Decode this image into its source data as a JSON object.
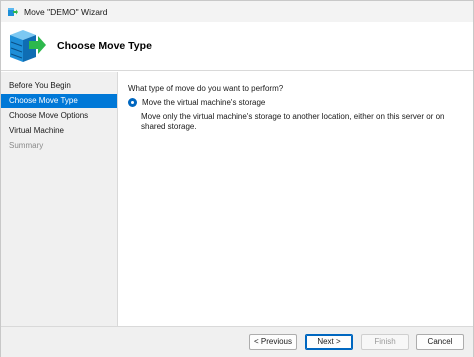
{
  "window": {
    "title": "Move \"DEMO\" Wizard"
  },
  "header": {
    "title": "Choose Move Type",
    "icon": "server-move-arrow-icon"
  },
  "nav": {
    "items": [
      {
        "label": "Before You Begin",
        "state": "normal"
      },
      {
        "label": "Choose Move Type",
        "state": "selected"
      },
      {
        "label": "Choose Move Options",
        "state": "normal"
      },
      {
        "label": "Virtual Machine",
        "state": "normal"
      },
      {
        "label": "Summary",
        "state": "disabled"
      }
    ]
  },
  "content": {
    "question": "What type of move do you want to perform?",
    "option": {
      "label": "Move the virtual machine's storage",
      "selected": true,
      "description": "Move only the virtual machine's storage to another location, either on this server or on shared storage."
    }
  },
  "footer": {
    "previous": "< Previous",
    "next": "Next >",
    "finish": "Finish",
    "cancel": "Cancel"
  },
  "colors": {
    "accent": "#0078d7",
    "icon_green": "#2db84d",
    "icon_blue": "#1e8fd8"
  }
}
